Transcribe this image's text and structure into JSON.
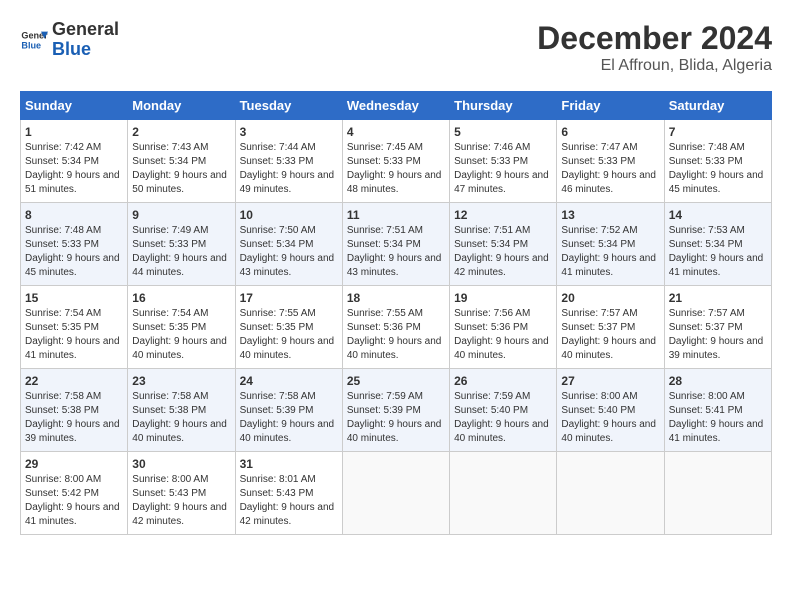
{
  "header": {
    "logo_line1": "General",
    "logo_line2": "Blue",
    "title": "December 2024",
    "subtitle": "El Affroun, Blida, Algeria"
  },
  "weekdays": [
    "Sunday",
    "Monday",
    "Tuesday",
    "Wednesday",
    "Thursday",
    "Friday",
    "Saturday"
  ],
  "weeks": [
    [
      {
        "day": "1",
        "sunrise": "7:42 AM",
        "sunset": "5:34 PM",
        "daylight": "9 hours and 51 minutes."
      },
      {
        "day": "2",
        "sunrise": "7:43 AM",
        "sunset": "5:34 PM",
        "daylight": "9 hours and 50 minutes."
      },
      {
        "day": "3",
        "sunrise": "7:44 AM",
        "sunset": "5:33 PM",
        "daylight": "9 hours and 49 minutes."
      },
      {
        "day": "4",
        "sunrise": "7:45 AM",
        "sunset": "5:33 PM",
        "daylight": "9 hours and 48 minutes."
      },
      {
        "day": "5",
        "sunrise": "7:46 AM",
        "sunset": "5:33 PM",
        "daylight": "9 hours and 47 minutes."
      },
      {
        "day": "6",
        "sunrise": "7:47 AM",
        "sunset": "5:33 PM",
        "daylight": "9 hours and 46 minutes."
      },
      {
        "day": "7",
        "sunrise": "7:48 AM",
        "sunset": "5:33 PM",
        "daylight": "9 hours and 45 minutes."
      }
    ],
    [
      {
        "day": "8",
        "sunrise": "7:48 AM",
        "sunset": "5:33 PM",
        "daylight": "9 hours and 45 minutes."
      },
      {
        "day": "9",
        "sunrise": "7:49 AM",
        "sunset": "5:33 PM",
        "daylight": "9 hours and 44 minutes."
      },
      {
        "day": "10",
        "sunrise": "7:50 AM",
        "sunset": "5:34 PM",
        "daylight": "9 hours and 43 minutes."
      },
      {
        "day": "11",
        "sunrise": "7:51 AM",
        "sunset": "5:34 PM",
        "daylight": "9 hours and 43 minutes."
      },
      {
        "day": "12",
        "sunrise": "7:51 AM",
        "sunset": "5:34 PM",
        "daylight": "9 hours and 42 minutes."
      },
      {
        "day": "13",
        "sunrise": "7:52 AM",
        "sunset": "5:34 PM",
        "daylight": "9 hours and 41 minutes."
      },
      {
        "day": "14",
        "sunrise": "7:53 AM",
        "sunset": "5:34 PM",
        "daylight": "9 hours and 41 minutes."
      }
    ],
    [
      {
        "day": "15",
        "sunrise": "7:54 AM",
        "sunset": "5:35 PM",
        "daylight": "9 hours and 41 minutes."
      },
      {
        "day": "16",
        "sunrise": "7:54 AM",
        "sunset": "5:35 PM",
        "daylight": "9 hours and 40 minutes."
      },
      {
        "day": "17",
        "sunrise": "7:55 AM",
        "sunset": "5:35 PM",
        "daylight": "9 hours and 40 minutes."
      },
      {
        "day": "18",
        "sunrise": "7:55 AM",
        "sunset": "5:36 PM",
        "daylight": "9 hours and 40 minutes."
      },
      {
        "day": "19",
        "sunrise": "7:56 AM",
        "sunset": "5:36 PM",
        "daylight": "9 hours and 40 minutes."
      },
      {
        "day": "20",
        "sunrise": "7:57 AM",
        "sunset": "5:37 PM",
        "daylight": "9 hours and 40 minutes."
      },
      {
        "day": "21",
        "sunrise": "7:57 AM",
        "sunset": "5:37 PM",
        "daylight": "9 hours and 39 minutes."
      }
    ],
    [
      {
        "day": "22",
        "sunrise": "7:58 AM",
        "sunset": "5:38 PM",
        "daylight": "9 hours and 39 minutes."
      },
      {
        "day": "23",
        "sunrise": "7:58 AM",
        "sunset": "5:38 PM",
        "daylight": "9 hours and 40 minutes."
      },
      {
        "day": "24",
        "sunrise": "7:58 AM",
        "sunset": "5:39 PM",
        "daylight": "9 hours and 40 minutes."
      },
      {
        "day": "25",
        "sunrise": "7:59 AM",
        "sunset": "5:39 PM",
        "daylight": "9 hours and 40 minutes."
      },
      {
        "day": "26",
        "sunrise": "7:59 AM",
        "sunset": "5:40 PM",
        "daylight": "9 hours and 40 minutes."
      },
      {
        "day": "27",
        "sunrise": "8:00 AM",
        "sunset": "5:40 PM",
        "daylight": "9 hours and 40 minutes."
      },
      {
        "day": "28",
        "sunrise": "8:00 AM",
        "sunset": "5:41 PM",
        "daylight": "9 hours and 41 minutes."
      }
    ],
    [
      {
        "day": "29",
        "sunrise": "8:00 AM",
        "sunset": "5:42 PM",
        "daylight": "9 hours and 41 minutes."
      },
      {
        "day": "30",
        "sunrise": "8:00 AM",
        "sunset": "5:43 PM",
        "daylight": "9 hours and 42 minutes."
      },
      {
        "day": "31",
        "sunrise": "8:01 AM",
        "sunset": "5:43 PM",
        "daylight": "9 hours and 42 minutes."
      },
      null,
      null,
      null,
      null
    ]
  ]
}
